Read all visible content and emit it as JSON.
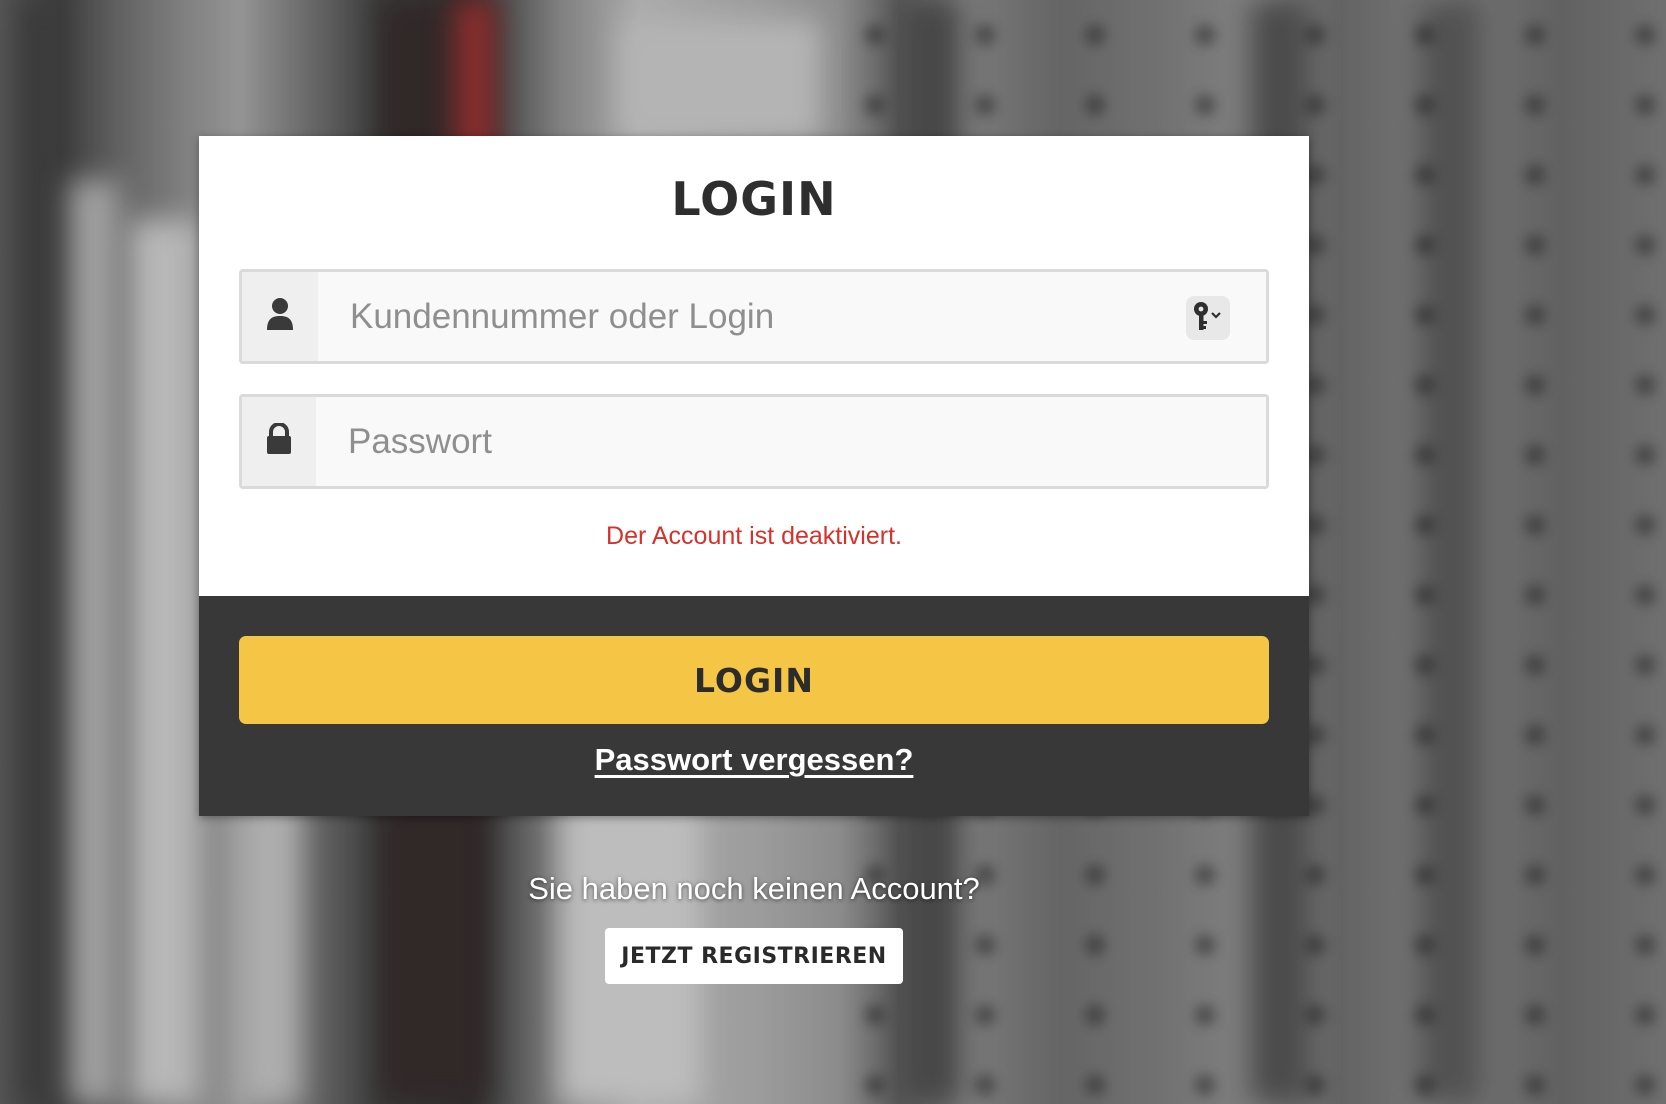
{
  "card": {
    "title": "LOGIN"
  },
  "username_field": {
    "placeholder": "Kundennummer oder Login",
    "value": ""
  },
  "password_field": {
    "placeholder": "Passwort",
    "value": ""
  },
  "error_message": "Der Account ist deaktiviert.",
  "login_button_label": "LOGIN",
  "forgot_password_label": "Passwort vergessen?",
  "register": {
    "prompt": "Sie haben noch keinen Account?",
    "button_label": "JETZT REGISTRIEREN"
  },
  "icons": {
    "user": "user-icon",
    "lock": "lock-icon",
    "key": "key-icon"
  },
  "colors": {
    "accent": "#f5c546",
    "error": "#d6312b",
    "card_footer": "#383838"
  }
}
